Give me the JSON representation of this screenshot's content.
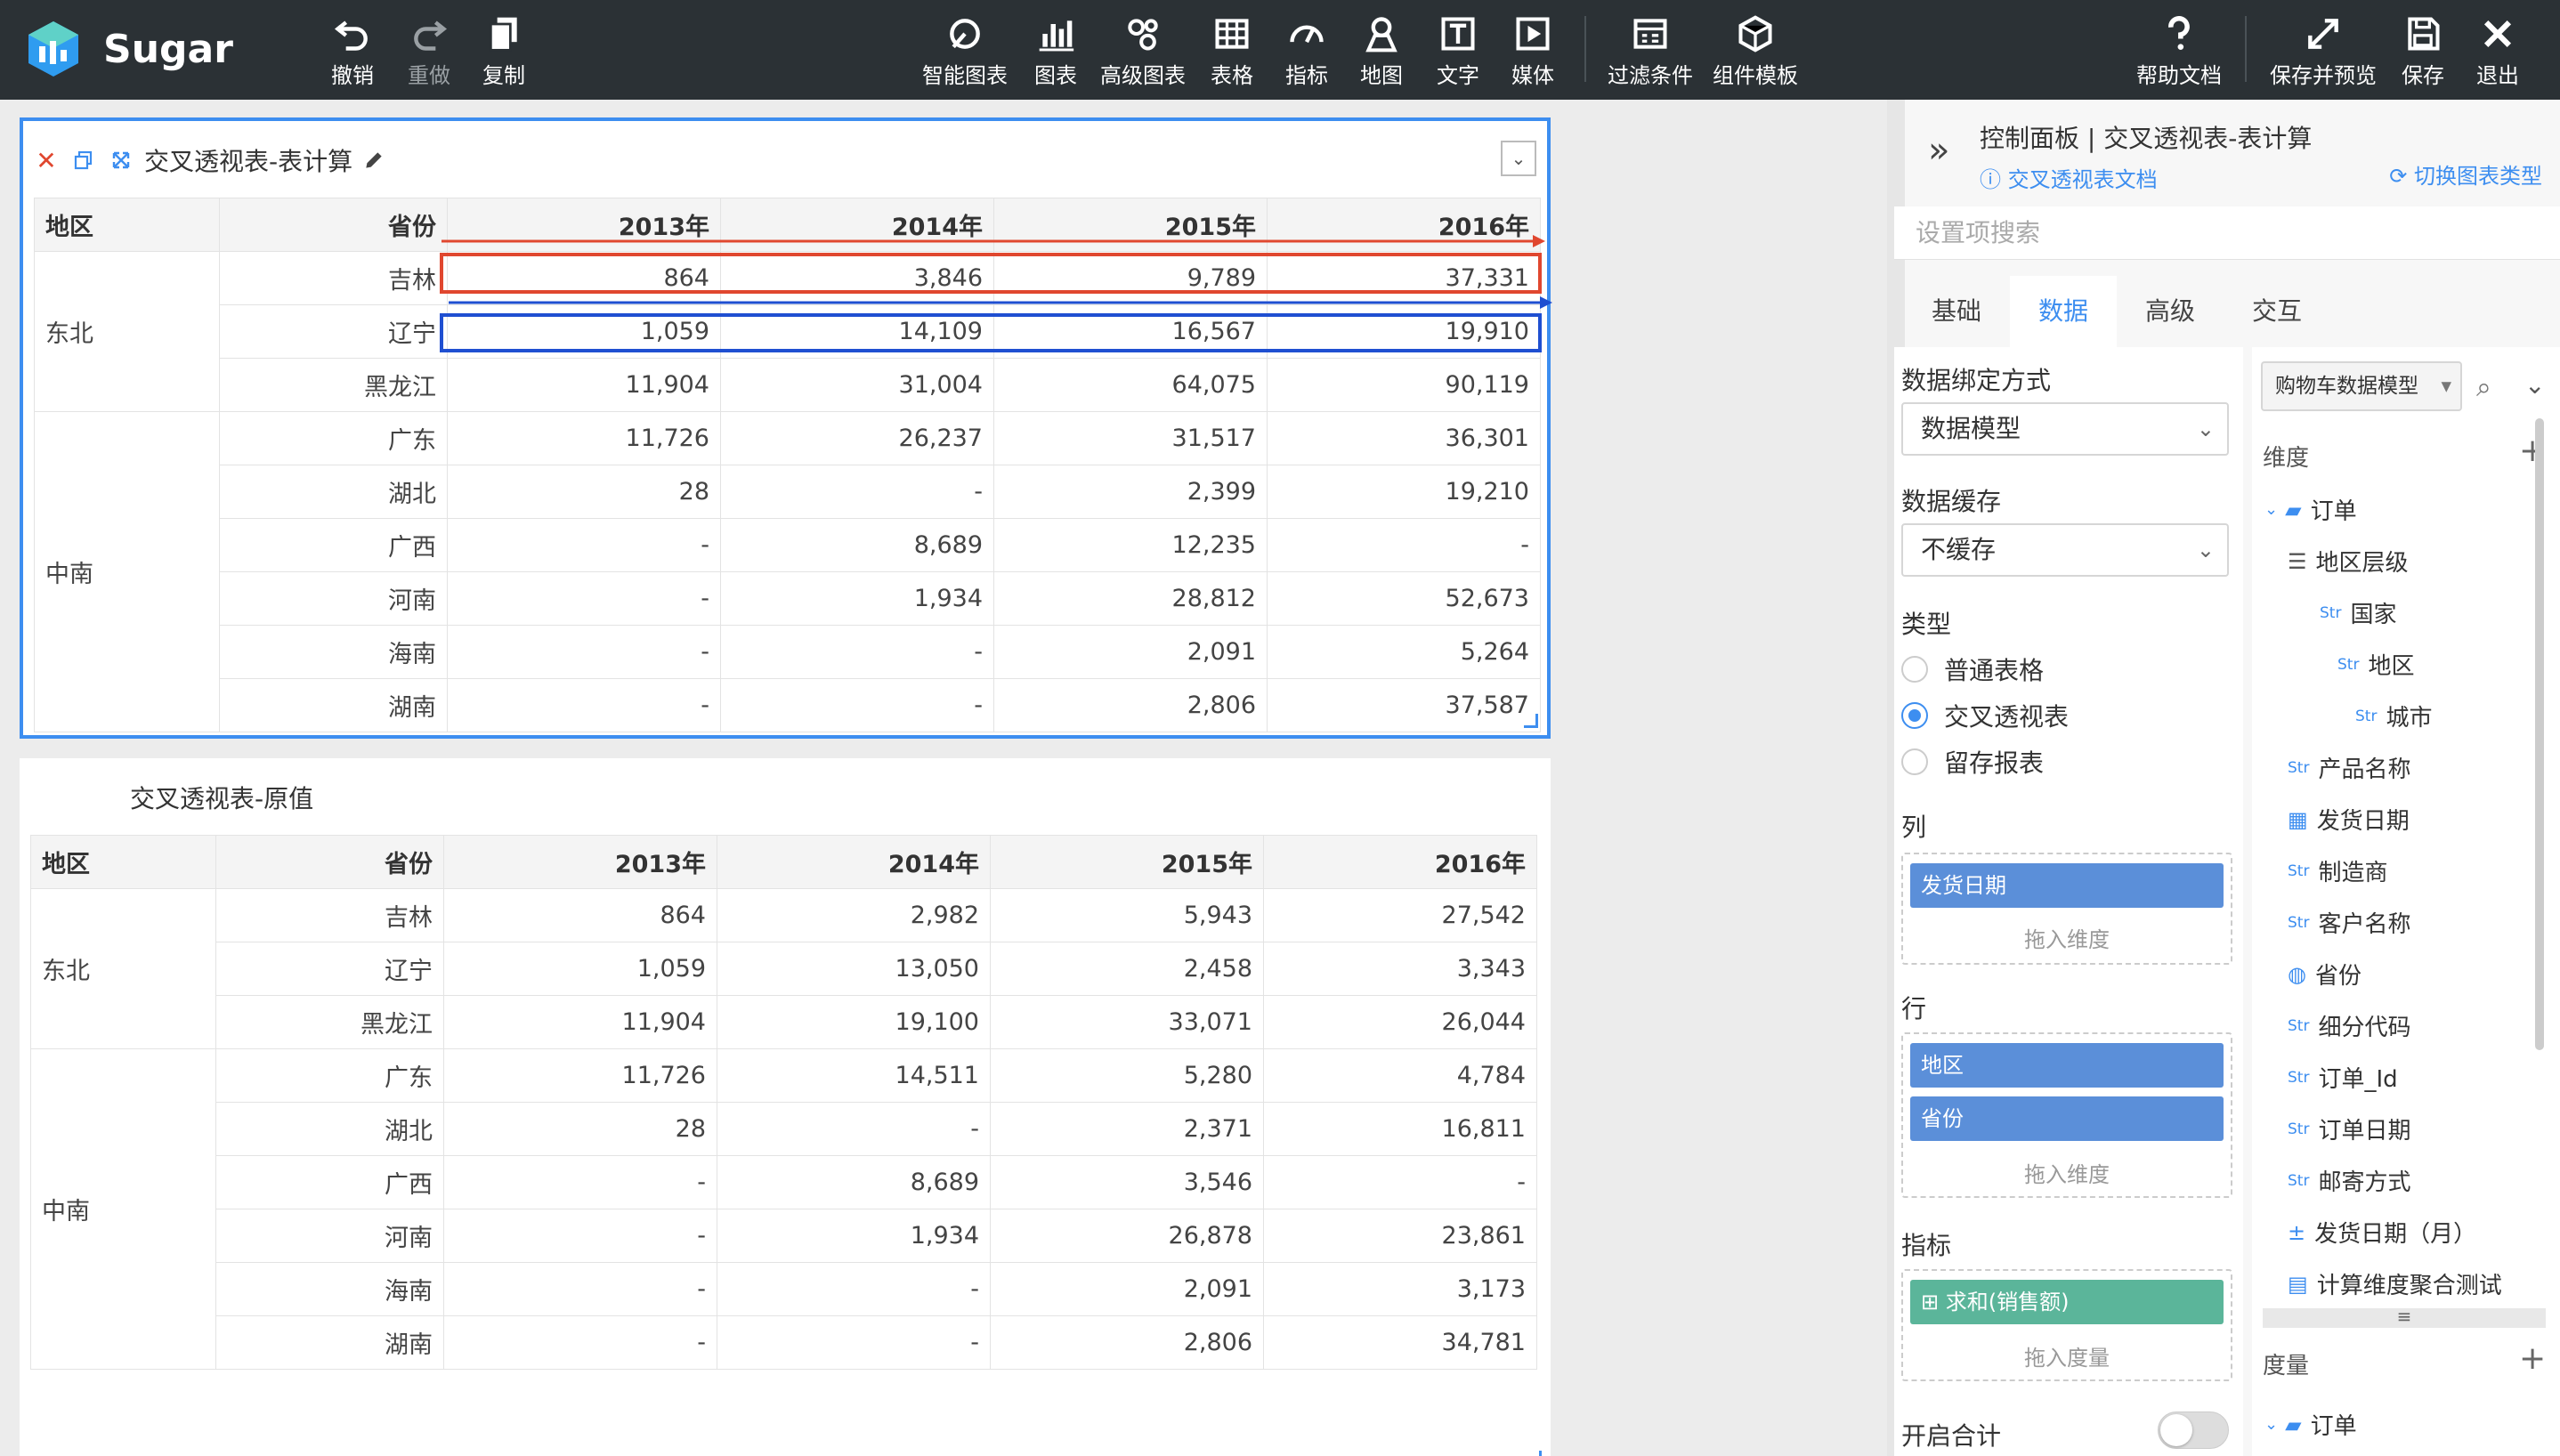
{
  "app": {
    "name": "Sugar"
  },
  "toolbar": {
    "undo": "撤销",
    "redo": "重做",
    "copy": "复制",
    "smart_chart": "智能图表",
    "chart": "图表",
    "advanced_chart": "高级图表",
    "table": "表格",
    "indicator": "指标",
    "map": "地图",
    "text": "文字",
    "media": "媒体",
    "filter": "过滤条件",
    "component_template": "组件模板",
    "help": "帮助文档",
    "save_preview": "保存并预览",
    "save": "保存",
    "exit": "退出"
  },
  "card1": {
    "title": "交叉透视表-表计算"
  },
  "card2": {
    "title": "交叉透视表-原值"
  },
  "columns": [
    "地区",
    "省份",
    "2013年",
    "2014年",
    "2015年",
    "2016年"
  ],
  "table1": {
    "groups": [
      {
        "region": "东北",
        "rows": [
          {
            "province": "吉林",
            "values": [
              "864",
              "3,846",
              "9,789",
              "37,331"
            ]
          },
          {
            "province": "辽宁",
            "values": [
              "1,059",
              "14,109",
              "16,567",
              "19,910"
            ]
          },
          {
            "province": "黑龙江",
            "values": [
              "11,904",
              "31,004",
              "64,075",
              "90,119"
            ]
          }
        ]
      },
      {
        "region": "中南",
        "rows": [
          {
            "province": "广东",
            "values": [
              "11,726",
              "26,237",
              "31,517",
              "36,301"
            ]
          },
          {
            "province": "湖北",
            "values": [
              "28",
              "-",
              "2,399",
              "19,210"
            ]
          },
          {
            "province": "广西",
            "values": [
              "-",
              "8,689",
              "12,235",
              "-"
            ]
          },
          {
            "province": "河南",
            "values": [
              "-",
              "1,934",
              "28,812",
              "52,673"
            ]
          },
          {
            "province": "海南",
            "values": [
              "-",
              "-",
              "2,091",
              "5,264"
            ]
          },
          {
            "province": "湖南",
            "values": [
              "-",
              "-",
              "2,806",
              "37,587"
            ]
          }
        ]
      }
    ]
  },
  "table2": {
    "groups": [
      {
        "region": "东北",
        "rows": [
          {
            "province": "吉林",
            "values": [
              "864",
              "2,982",
              "5,943",
              "27,542"
            ]
          },
          {
            "province": "辽宁",
            "values": [
              "1,059",
              "13,050",
              "2,458",
              "3,343"
            ]
          },
          {
            "province": "黑龙江",
            "values": [
              "11,904",
              "19,100",
              "33,071",
              "26,044"
            ]
          }
        ]
      },
      {
        "region": "中南",
        "rows": [
          {
            "province": "广东",
            "values": [
              "11,726",
              "14,511",
              "5,280",
              "4,784"
            ]
          },
          {
            "province": "湖北",
            "values": [
              "28",
              "-",
              "2,371",
              "16,811"
            ]
          },
          {
            "province": "广西",
            "values": [
              "-",
              "8,689",
              "3,546",
              "-"
            ]
          },
          {
            "province": "河南",
            "values": [
              "-",
              "1,934",
              "26,878",
              "23,861"
            ]
          },
          {
            "province": "海南",
            "values": [
              "-",
              "-",
              "2,091",
              "3,173"
            ]
          },
          {
            "province": "湖南",
            "values": [
              "-",
              "-",
              "2,806",
              "34,781"
            ]
          }
        ]
      }
    ]
  },
  "panel": {
    "title": "控制面板 | 交叉透视表-表计算",
    "doc_link": "交叉透视表文档",
    "switch_type": "切换图表类型",
    "search_placeholder": "设置项搜索",
    "tabs": [
      "基础",
      "数据",
      "高级",
      "交互"
    ],
    "active_tab": "数据",
    "bind_label": "数据绑定方式",
    "bind_value": "数据模型",
    "cache_label": "数据缓存",
    "cache_value": "不缓存",
    "type_label": "类型",
    "types": [
      "普通表格",
      "交叉透视表",
      "留存报表"
    ],
    "selected_type": "交叉透视表",
    "col_label": "列",
    "col_pills": [
      "发货日期"
    ],
    "drop_dimension": "拖入维度",
    "row_label": "行",
    "row_pills": [
      "地区",
      "省份"
    ],
    "measure_label": "指标",
    "measure_pills": [
      "求和(销售额)"
    ],
    "drop_measure": "拖入度量",
    "total_label": "开启合计"
  },
  "fields": {
    "model": "购物车数据模型",
    "dimension_label": "维度",
    "measure_label": "度量",
    "folder": "订单",
    "str_tag": "Str",
    "items": [
      "地区层级",
      "国家",
      "地区",
      "城市",
      "产品名称",
      "发货日期",
      "制造商",
      "客户名称",
      "省份",
      "细分代码",
      "订单_Id",
      "订单日期",
      "邮寄方式",
      "发货日期（月）",
      "计算维度聚合测试"
    ],
    "measure_folder": "订单"
  },
  "colors": {
    "accent": "#3d8ef0",
    "topbar": "#2b3135",
    "pill_blue": "#5b8fd9",
    "pill_green": "#5bb59a",
    "highlight_red": "#e0472f",
    "highlight_blue": "#1f4fd1"
  }
}
